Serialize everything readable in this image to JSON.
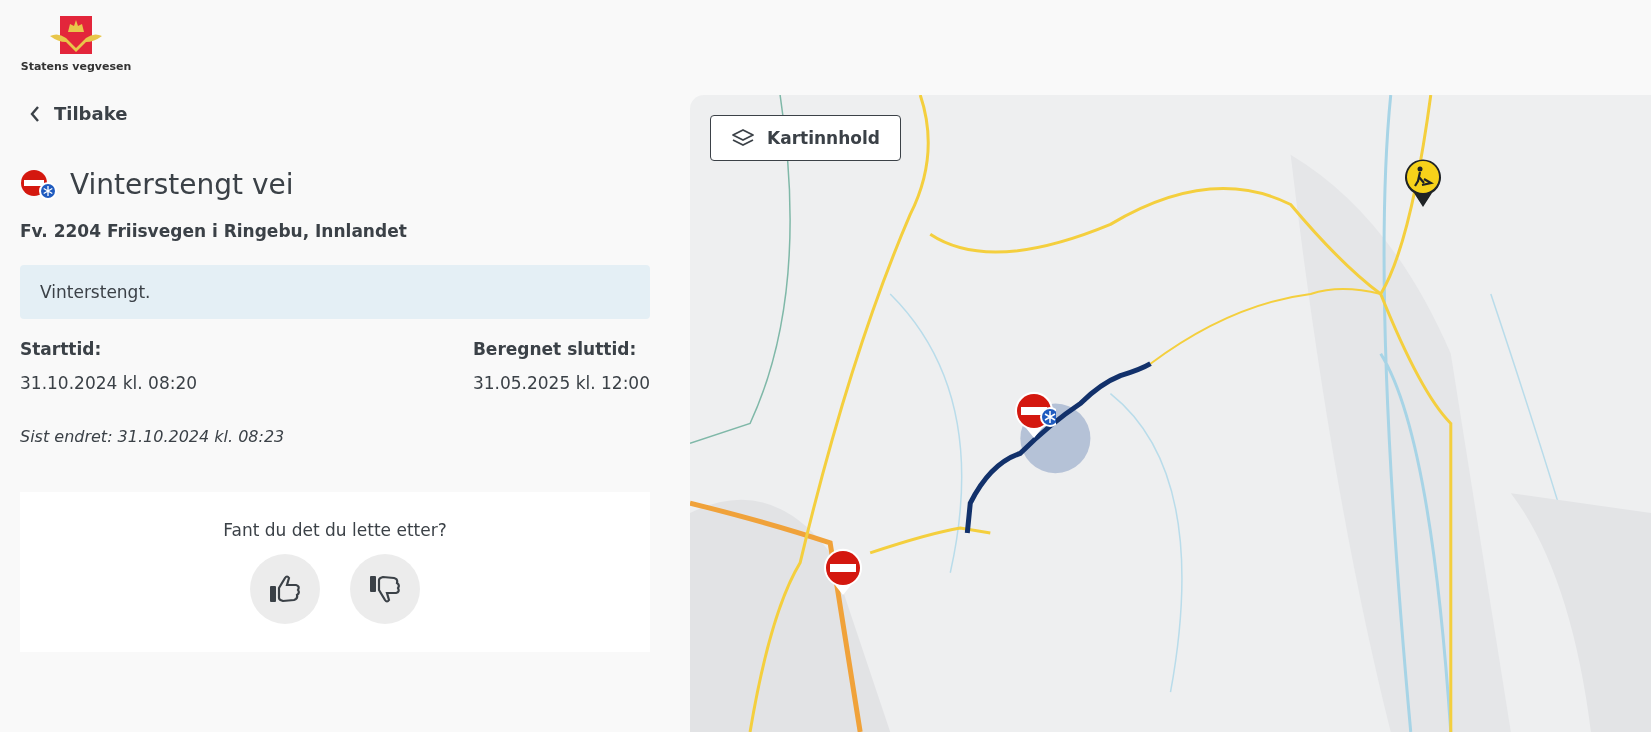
{
  "logo": {
    "text": "Statens vegvesen"
  },
  "back": {
    "label": "Tilbake"
  },
  "title": "Vinterstengt vei",
  "road": "Fv. 2204 Friisvegen i Ringebu, Innlandet",
  "description": "Vinterstengt.",
  "times": [
    {
      "label": "Starttid:",
      "value": "31.10.2024 kl. 08:20"
    },
    {
      "label": "Beregnet sluttid:",
      "value": "31.05.2025 kl. 12:00"
    }
  ],
  "last_changed": "Sist endret: 31.10.2024 kl. 08:23",
  "feedback": {
    "question": "Fant du det du lette etter?"
  },
  "map": {
    "kind": "picture",
    "layers_button": "Kartinnhold"
  }
}
